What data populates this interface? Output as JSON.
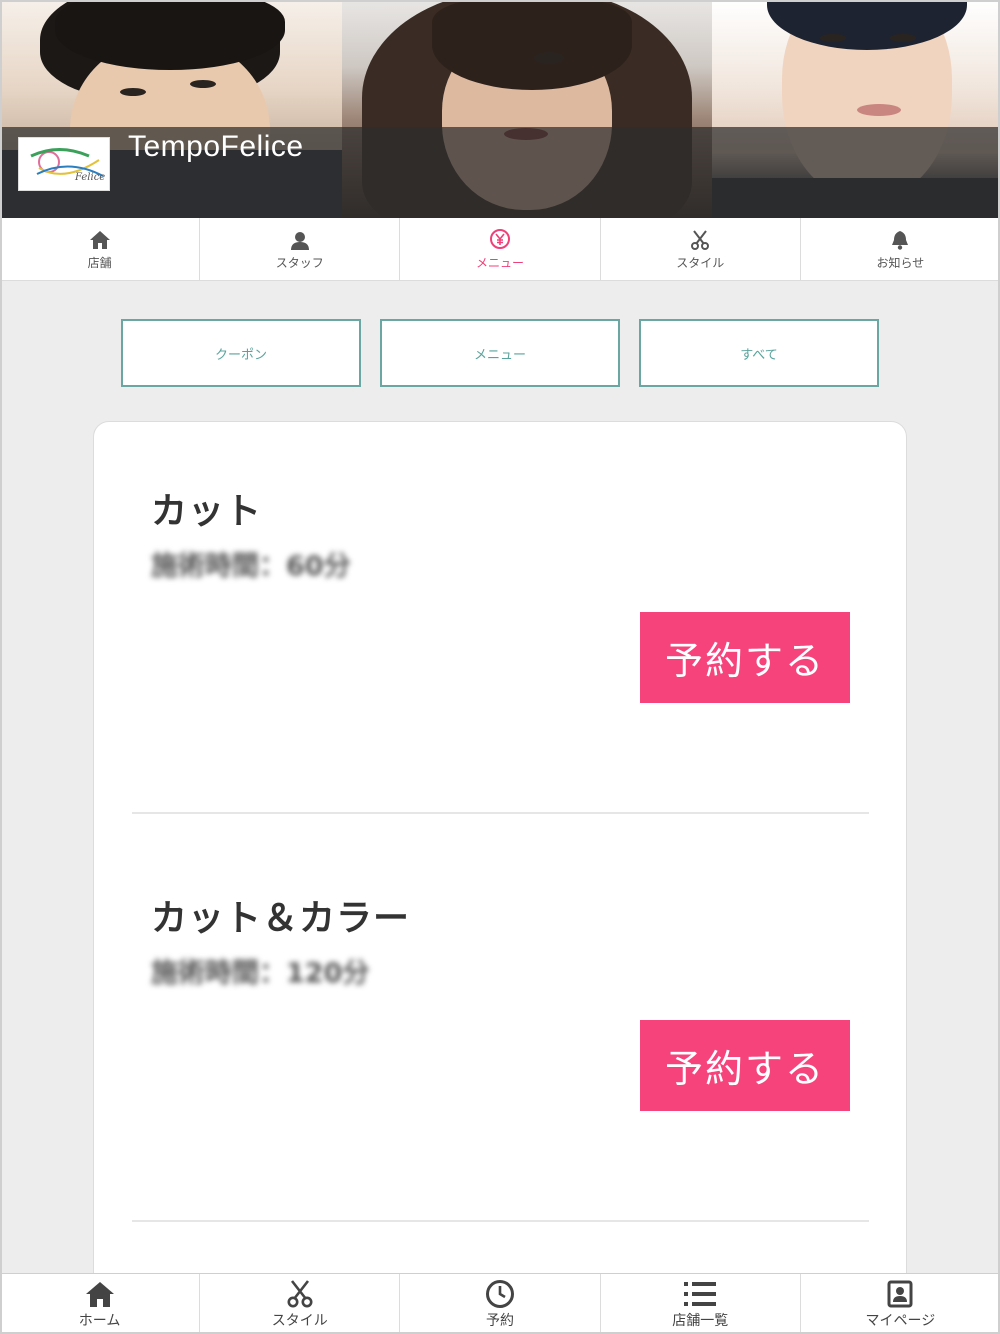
{
  "header": {
    "salon_name": "TempoFelice",
    "logo_text": "Felice"
  },
  "top_nav": {
    "tabs": [
      {
        "label": "店舗",
        "icon": "home-icon",
        "active": false
      },
      {
        "label": "スタッフ",
        "icon": "person-icon",
        "active": false
      },
      {
        "label": "メニュー",
        "icon": "yen-icon",
        "active": true
      },
      {
        "label": "スタイル",
        "icon": "scissors-icon",
        "active": false
      },
      {
        "label": "お知らせ",
        "icon": "bell-icon",
        "active": false
      }
    ]
  },
  "filters": {
    "coupon": "クーポン",
    "menu": "メニュー",
    "all": "すべて"
  },
  "menu_items": [
    {
      "name": "カット",
      "time": "施術時間：60分",
      "reserve_label": "予約する"
    },
    {
      "name": "カット＆カラー",
      "time": "施術時間：120分",
      "reserve_label": "予約する"
    }
  ],
  "bottom_nav": {
    "tabs": [
      {
        "label": "ホーム",
        "icon": "home-icon"
      },
      {
        "label": "スタイル",
        "icon": "scissors-icon"
      },
      {
        "label": "予約",
        "icon": "clock-icon"
      },
      {
        "label": "店舗一覧",
        "icon": "list-icon"
      },
      {
        "label": "マイページ",
        "icon": "profile-icon"
      }
    ]
  },
  "colors": {
    "accent": "#f7437c",
    "active_tab": "#f0407a",
    "filter_border": "#6aa7a2",
    "background": "#ededed"
  }
}
